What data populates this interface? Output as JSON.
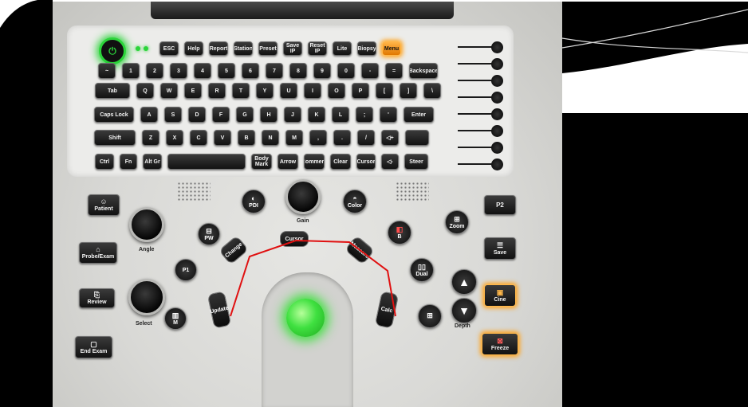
{
  "power_led_color": "#2bd43a",
  "accent_glow": "#ffa21a",
  "function_row": [
    "ESC",
    "Help",
    "Report",
    "Station",
    "Preset",
    "Save IP",
    "Reset IP",
    "Lite",
    "Biopsy",
    "Menu"
  ],
  "number_row": [
    "~",
    "1",
    "2",
    "3",
    "4",
    "5",
    "6",
    "7",
    "8",
    "9",
    "0",
    "-",
    "=",
    "Backspace"
  ],
  "qwerty_row": [
    "Tab",
    "Q",
    "W",
    "E",
    "R",
    "T",
    "Y",
    "U",
    "I",
    "O",
    "P",
    "[",
    "]",
    "\\"
  ],
  "asdf_row": [
    "Caps Lock",
    "A",
    "S",
    "D",
    "F",
    "G",
    "H",
    "J",
    "K",
    "L",
    ";",
    "'",
    "Enter"
  ],
  "zxcv_row": [
    "Shift",
    "Z",
    "X",
    "C",
    "V",
    "B",
    "N",
    "M",
    ",",
    ".",
    "/",
    "◁+",
    ""
  ],
  "bottom_row": [
    "Ctrl",
    "Fn",
    "Alt Gr",
    "",
    "Body Mark",
    "Arrow",
    "Comment",
    "Clear",
    "Cursor",
    "◁-",
    "Steer"
  ],
  "left_buttons": {
    "patient": "Patient",
    "probe": "Probe/Exam",
    "review": "Review",
    "end_exam": "End Exam"
  },
  "knob_labels": {
    "angle": "Angle",
    "select": "Select",
    "gain": "Gain",
    "depth": "Depth"
  },
  "mode_buttons": {
    "pdi": "PDI",
    "color": "Color",
    "pw": "PW",
    "p1": "P1",
    "m": "M",
    "b": "B",
    "zoom": "Zoom",
    "dual": "Dual",
    "quad": "",
    "p2": "P2",
    "save": "Save",
    "cine": "Cine",
    "freeze": "Freeze"
  },
  "arc_buttons": [
    "Update",
    "Change",
    "Cursor",
    "Measure",
    "Calc"
  ],
  "icons": {
    "power": "power-icon",
    "patient": "person-icon",
    "probe": "probe-icon",
    "review": "review-icon",
    "end": "end-exam-icon",
    "up": "triangle-up-icon",
    "down": "triangle-down-icon"
  }
}
